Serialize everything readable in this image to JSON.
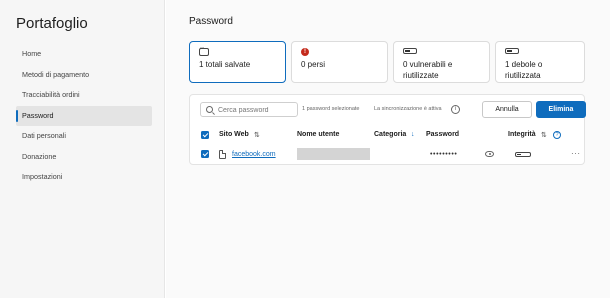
{
  "sidebar": {
    "title": "Portafoglio",
    "items": [
      {
        "label": "Home"
      },
      {
        "label": "Metodi di pagamento"
      },
      {
        "label": "Tracciabilità ordini"
      },
      {
        "label": "Password",
        "active": true
      },
      {
        "label": "Dati personali"
      },
      {
        "label": "Donazione"
      },
      {
        "label": "Impostazioni"
      }
    ]
  },
  "main": {
    "title": "Password",
    "cards": [
      {
        "label": "1 totali salvate",
        "icon": "password-icon",
        "selected": true
      },
      {
        "label": "0 persi",
        "icon": "error-icon",
        "icon_text": "!"
      },
      {
        "label": "0 vulnerabili e riutilizzate",
        "icon": "strength-bar-icon"
      },
      {
        "label": "1 debole o riutilizzata",
        "icon": "strength-bar-icon"
      }
    ],
    "toolbar": {
      "search_placeholder": "Cerca password",
      "selected_count": "1 password selezionate",
      "sync_status": "La sincronizzazione è attiva",
      "info_glyph": "i",
      "cancel_label": "Annulla",
      "delete_label": "Elimina"
    },
    "table": {
      "columns": {
        "site": "Sito Web",
        "username": "Nome utente",
        "category": "Categoria",
        "password": "Password",
        "integrity": "Integrità"
      },
      "sort_glyph": "⇅",
      "category_sort_glyph": "↓",
      "help_glyph": "?",
      "rows": [
        {
          "site": "facebook.com",
          "password": "•••••••••",
          "strength": 0.3,
          "more": "···"
        }
      ]
    }
  },
  "colors": {
    "accent": "#0f6cbd",
    "error": "#c42b1c"
  }
}
